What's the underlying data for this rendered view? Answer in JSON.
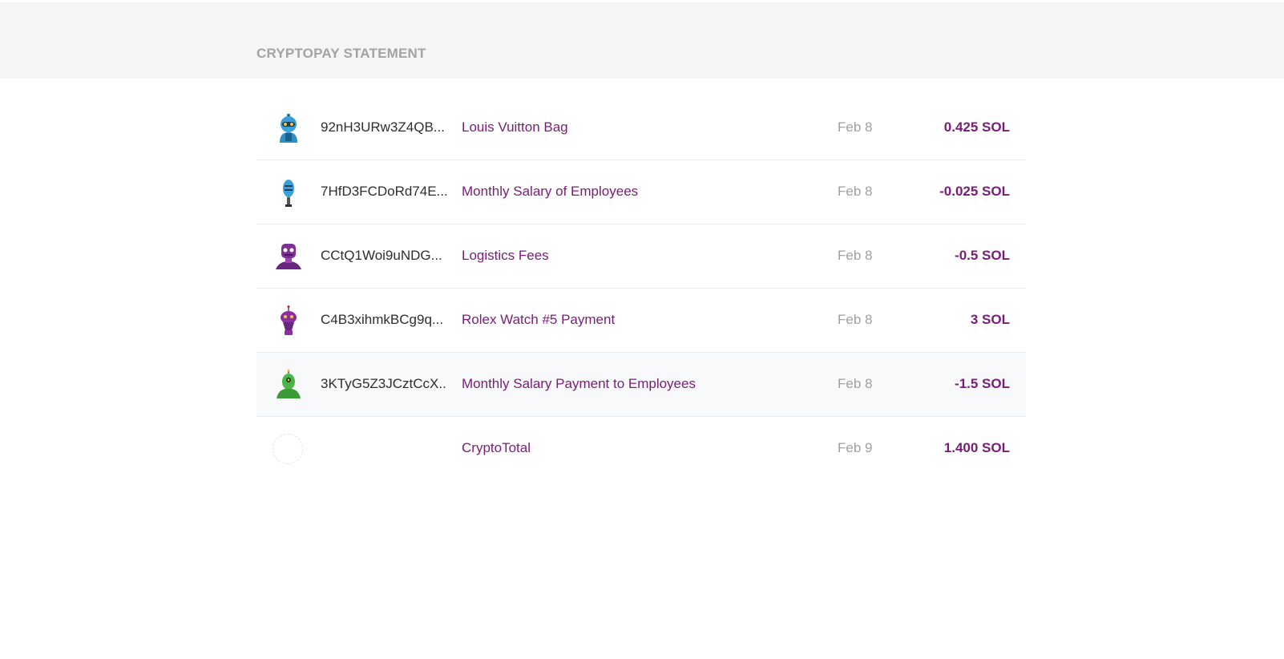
{
  "header": {
    "title": "CRYPTOPAY STATEMENT"
  },
  "transactions": [
    {
      "avatar_icon": "blue-robot-avatar-icon",
      "address": "92nH3URw3Z4QB...",
      "description": "Louis Vuitton Bag",
      "date": "Feb 8",
      "amount": "0.425 SOL"
    },
    {
      "avatar_icon": "blue-pill-robot-avatar-icon",
      "address": "7HfD3FCDoRd74E...",
      "description": "Monthly Salary of Employees",
      "date": "Feb 8",
      "amount": "-0.025 SOL"
    },
    {
      "avatar_icon": "purple-robot-avatar-icon",
      "address": "CCtQ1Woi9uNDG...",
      "description": "Logistics Fees",
      "date": "Feb 8",
      "amount": "-0.5 SOL"
    },
    {
      "avatar_icon": "purple-antenna-robot-avatar-icon",
      "address": "C4B3xihmkBCg9q...",
      "description": "Rolex Watch #5 Payment",
      "date": "Feb 8",
      "amount": "3 SOL"
    },
    {
      "avatar_icon": "green-alien-avatar-icon",
      "address": "3KTyG5Z3JCztCcX...",
      "description": "Monthly Salary Payment to Employees",
      "date": "Feb 8",
      "amount": "-1.5 SOL"
    }
  ],
  "total": {
    "avatar_icon": "empty-avatar-icon",
    "description": "CryptoTotal",
    "date": "Feb 9",
    "amount": "1.400 SOL"
  },
  "colors": {
    "accent": "#7b1b78",
    "header_bg": "#f5f5f5",
    "muted_text": "#a0a0a0",
    "highlight_row": "#f8f9fa"
  }
}
